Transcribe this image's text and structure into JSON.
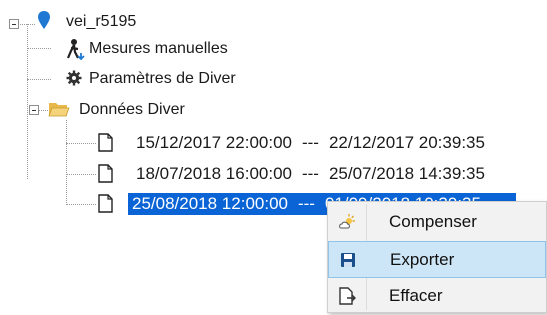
{
  "tree": {
    "root": {
      "label": "vei_r5195",
      "icon": "map-pin-icon"
    },
    "children": [
      {
        "label": "Mesures manuelles",
        "icon": "person-walk-icon"
      },
      {
        "label": "Paramètres de Diver",
        "icon": "gear-icon"
      },
      {
        "label": "Données Diver",
        "icon": "folder-open-icon"
      }
    ],
    "files": [
      {
        "start": "15/12/2017 22:00:00",
        "sep": "---",
        "end": "22/12/2017 20:39:35",
        "icon": "file-icon"
      },
      {
        "start": "18/07/2018 16:00:00",
        "sep": "---",
        "end": "25/07/2018 14:39:35",
        "icon": "file-icon"
      },
      {
        "start": "25/08/2018 12:00:00",
        "sep": "---",
        "end": "01/09/2018 10:39:35",
        "icon": "file-icon",
        "selected": true
      }
    ]
  },
  "context_menu": {
    "items": [
      {
        "label": "Compenser",
        "icon": "weather-sun-cloud-icon"
      },
      {
        "label": "Exporter",
        "icon": "save-icon",
        "highlighted": true
      },
      {
        "label": "Effacer",
        "icon": "delete-doc-icon"
      }
    ]
  },
  "colors": {
    "selection": "#0a64d6",
    "menu_hover": "#cde6f7",
    "pin": "#1f78d1",
    "folder": "#e8b84a"
  }
}
